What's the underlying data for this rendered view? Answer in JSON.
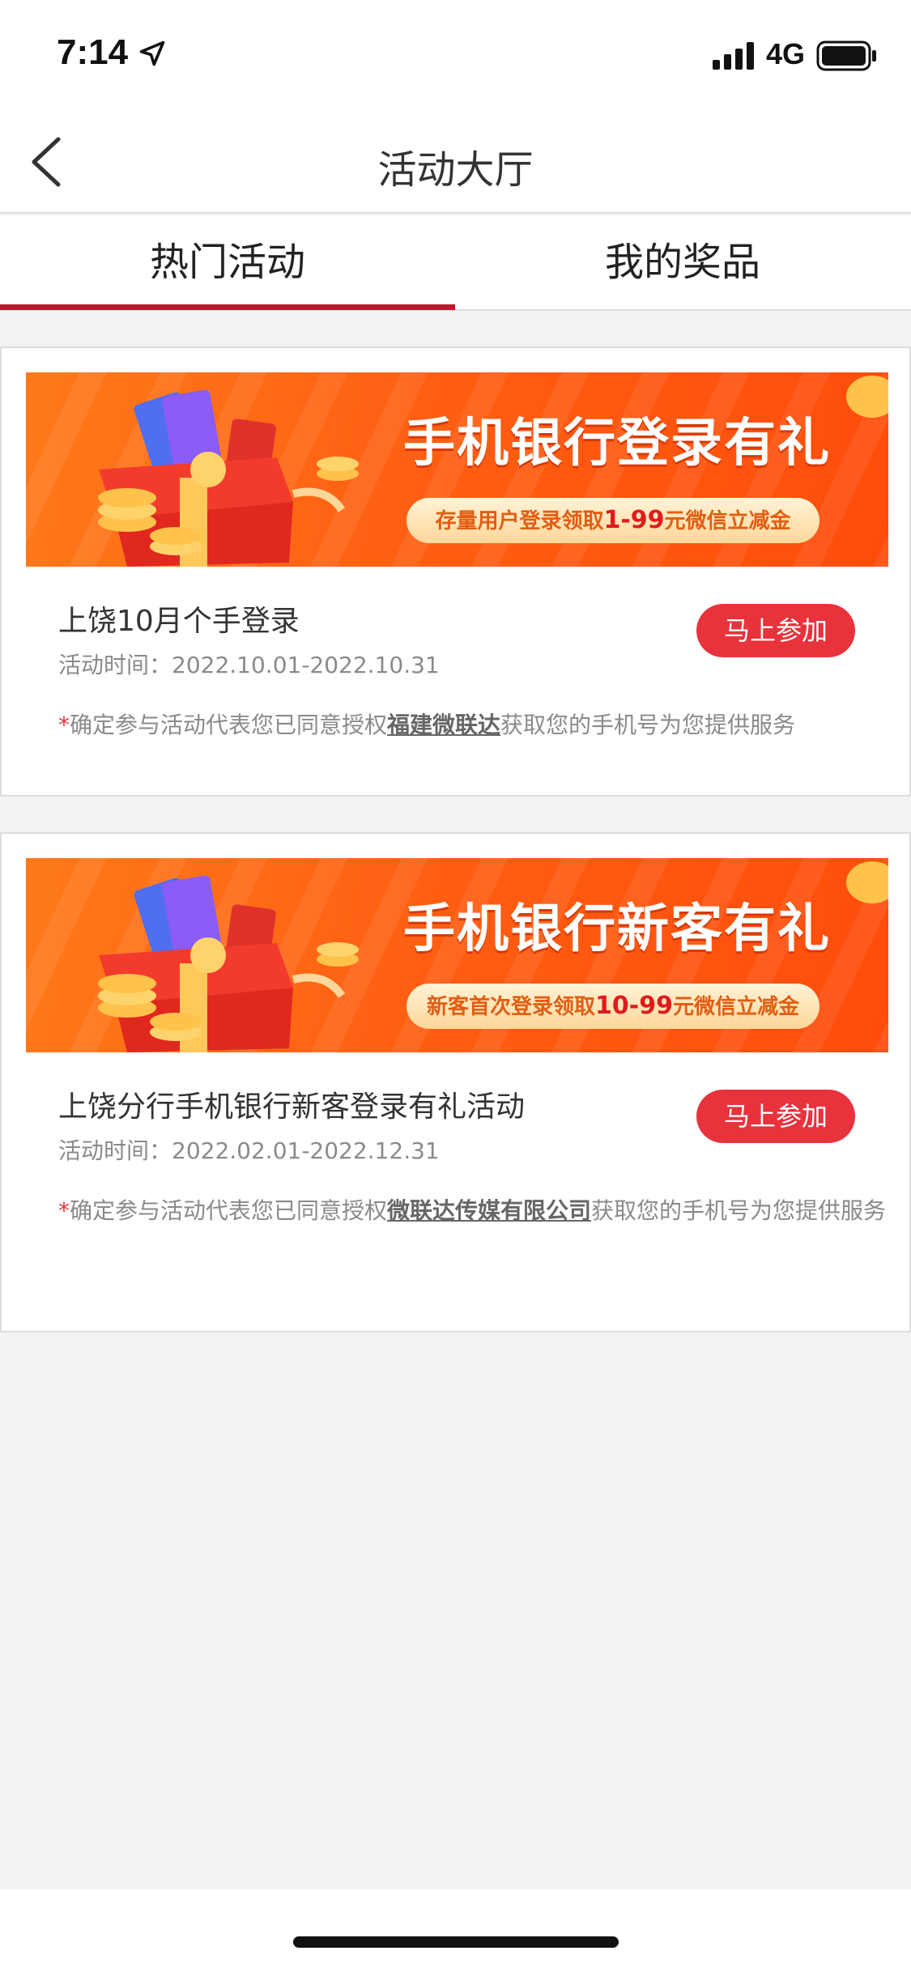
{
  "status_bar": {
    "time": "7:14",
    "network": "4G"
  },
  "nav": {
    "title": "活动大厅"
  },
  "tabs": [
    {
      "label": "热门活动",
      "active": true
    },
    {
      "label": "我的奖品",
      "active": false
    }
  ],
  "colors": {
    "accent": "#c8102e",
    "button": "#e8323c",
    "banner": "#ff5f12"
  },
  "activities": [
    {
      "banner": {
        "title": "手机银行登录有礼",
        "pill_prefix": "存量用户登录领取",
        "pill_highlight": "1-99",
        "pill_suffix": "元微信立减金"
      },
      "title": "上饶10月个手登录",
      "time": "活动时间：2022.10.01-2022.10.31",
      "join_label": "马上参加",
      "notice_prefix": "确定参与活动代表您已同意授权",
      "notice_company": "福建微联达",
      "notice_suffix": "获取您的手机号为您提供服务"
    },
    {
      "banner": {
        "title": "手机银行新客有礼",
        "pill_prefix": "新客首次登录领取",
        "pill_highlight": "10-99",
        "pill_suffix": "元微信立减金"
      },
      "title": "上饶分行手机银行新客登录有礼活动",
      "time": "活动时间：2022.02.01-2022.12.31",
      "join_label": "马上参加",
      "notice_prefix": "确定参与活动代表您已同意授权",
      "notice_company": "微联达传媒有限公司",
      "notice_suffix": "获取您的手机号为您提供服务"
    }
  ]
}
